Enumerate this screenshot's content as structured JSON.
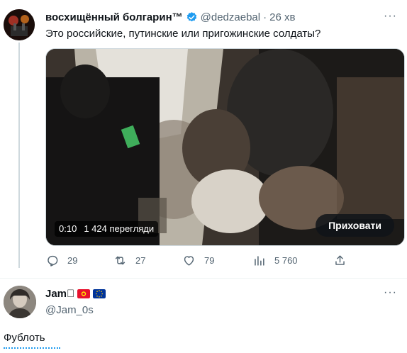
{
  "tweet": {
    "author_name": "восхищённый болгарин™",
    "handle": "@dedzaebal",
    "separator": "·",
    "time": "26 хв",
    "more_label": "···",
    "text": "Это российские, путинские или пригожинские солдаты?",
    "video": {
      "duration": "0:10",
      "views": "1 424 перегляди",
      "hide_label": "Приховати"
    },
    "actions": {
      "replies": "29",
      "retweets": "27",
      "likes": "79",
      "views": "5 760"
    }
  },
  "reply": {
    "author_name": "Jam\u0000",
    "flags": [
      "kyrgyzstan-flag",
      "eu-flag"
    ],
    "handle": "@Jam_0s",
    "more_label": "···",
    "text": "Фублоть"
  },
  "colors": {
    "verified_blue": "#1d9bf0",
    "secondary_text": "#536471",
    "primary_text": "#0f1419"
  }
}
